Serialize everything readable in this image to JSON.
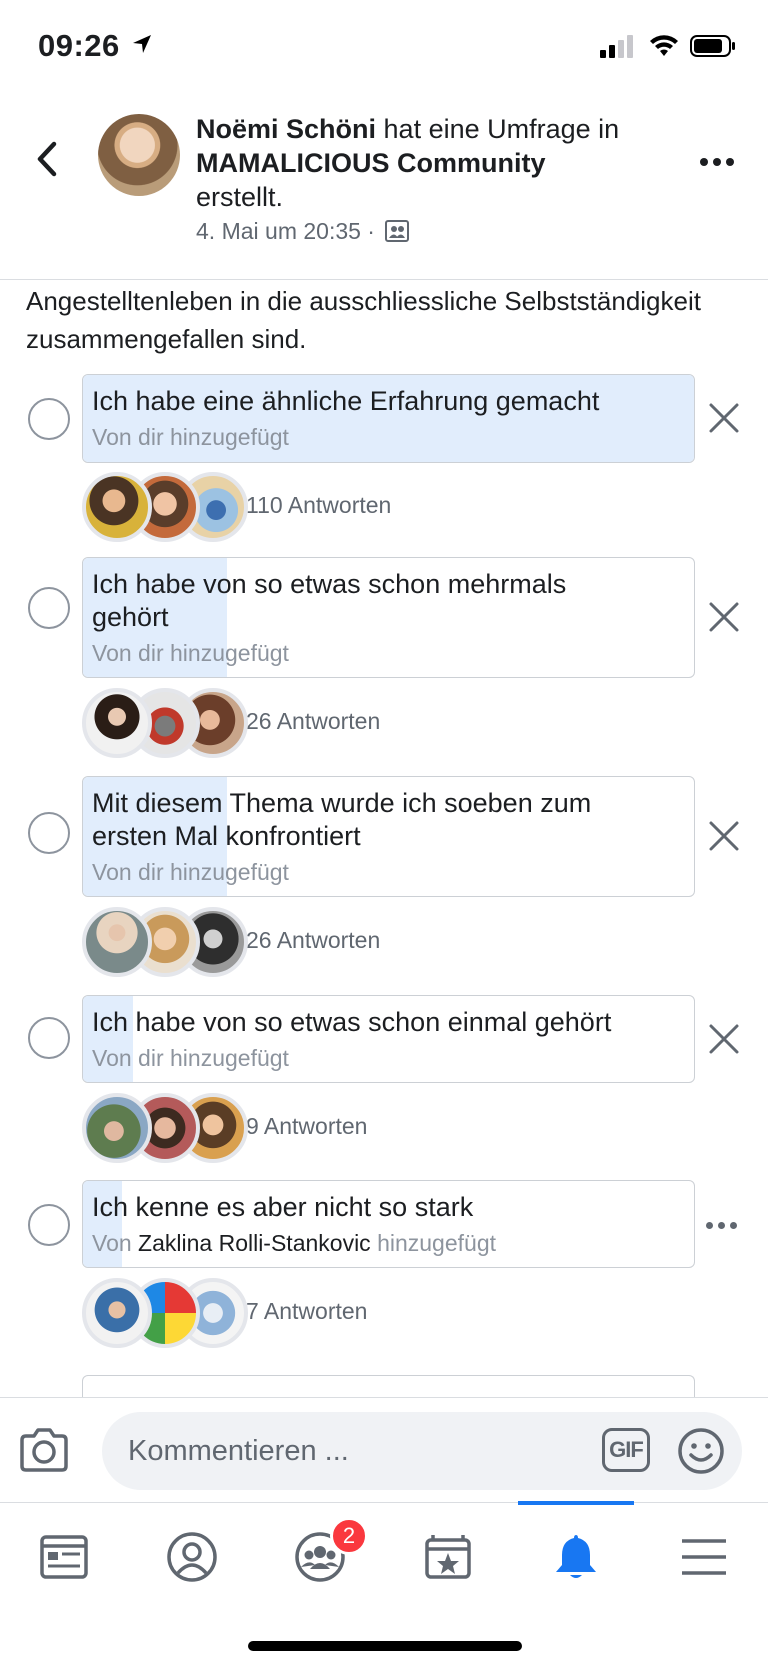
{
  "status_bar": {
    "time": "09:26"
  },
  "header": {
    "author": "Noëmi Schöni",
    "action_text": " hat eine Umfrage in ",
    "group": "MAMALICIOUS Community",
    "action_end": "erstellt.",
    "date": "4. Mai um 20:35 ·"
  },
  "question": "Angestelltenleben in die ausschliessliche Selbstständigkeit zusammengefallen sind.",
  "options": [
    {
      "label": "Ich habe eine ähnliche Erfahrung gemacht",
      "added_by": "Von dir hinzugefügt",
      "votes_text": "110 Antworten",
      "votes": 110,
      "action": "remove"
    },
    {
      "label": "Ich habe von so etwas schon mehrmals gehört",
      "added_by": "Von dir hinzugefügt",
      "votes_text": "26 Antworten",
      "votes": 26,
      "action": "remove"
    },
    {
      "label": "Mit diesem Thema wurde ich soeben zum ersten Mal konfrontiert",
      "added_by": "Von dir hinzugefügt",
      "votes_text": "26 Antworten",
      "votes": 26,
      "action": "remove"
    },
    {
      "label": "Ich habe von so etwas schon einmal gehört",
      "added_by": "Von dir hinzugefügt",
      "votes_text": "9 Antworten",
      "votes": 9,
      "action": "remove"
    },
    {
      "label": "Ich kenne es aber nicht so stark",
      "added_by_prefix": "Von ",
      "added_by_name": "Zaklina Rolli-Stankovic",
      "added_by_suffix": " hinzugefügt",
      "votes_text": "7 Antworten",
      "votes": 7,
      "action": "more"
    }
  ],
  "composer": {
    "placeholder": "Kommentieren ...",
    "gif_label": "GIF"
  },
  "tab_bar": {
    "groups_badge": "2",
    "active_tab": "notifications"
  },
  "colors": {
    "accent": "#1877f2",
    "poll_fill": "#e1edfc",
    "badge": "#fa383e"
  },
  "icons": [
    "back-icon",
    "more-icon",
    "audience-icon",
    "camera-icon",
    "gif-icon",
    "emoji-icon",
    "news-feed-icon",
    "profile-icon",
    "groups-icon",
    "pages-icon",
    "bell-icon",
    "menu-icon"
  ]
}
